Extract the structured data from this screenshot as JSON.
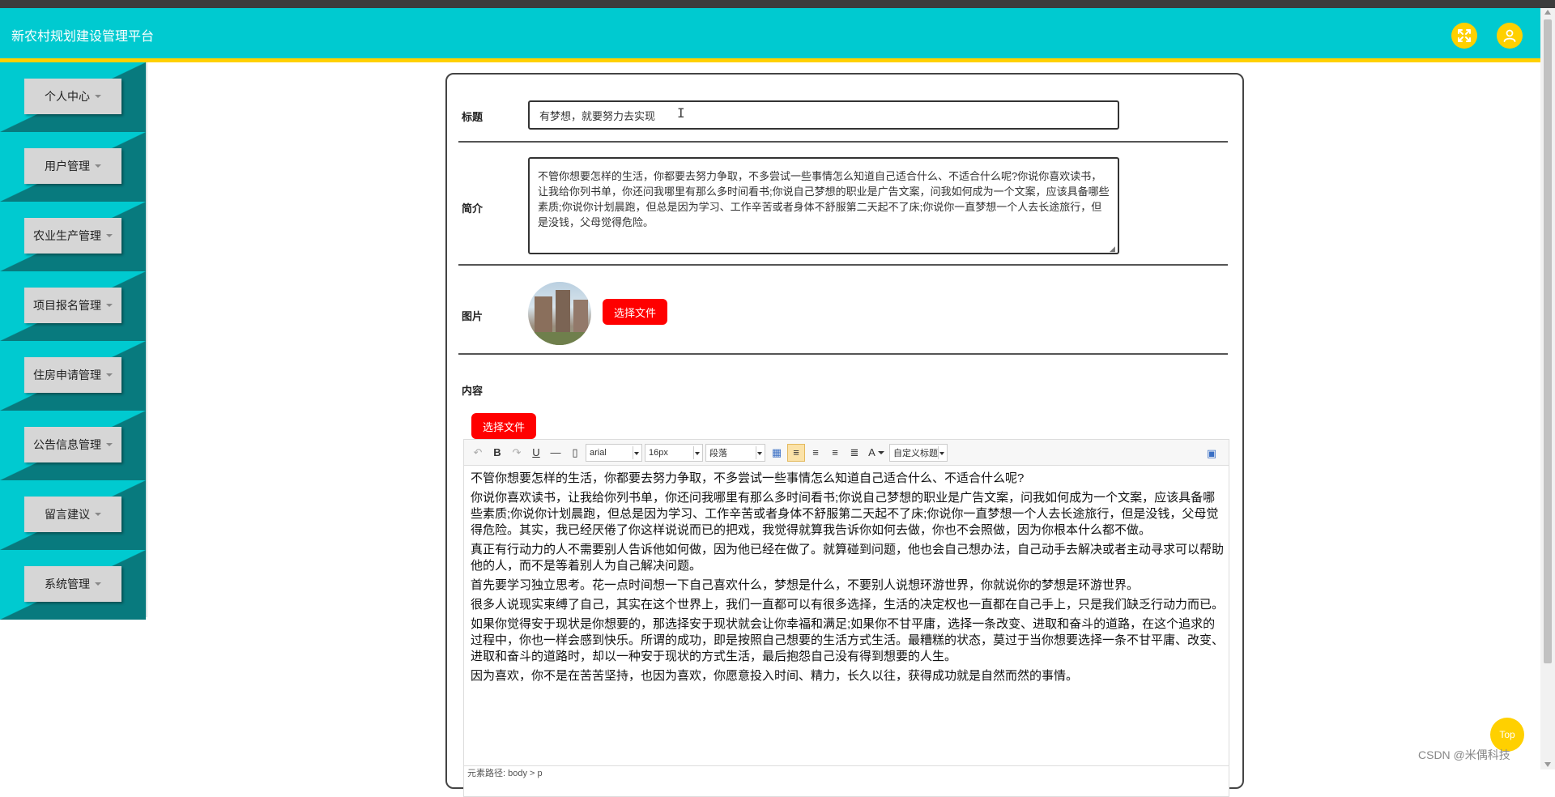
{
  "header": {
    "title": "新农村规划建设管理平台"
  },
  "sidebar": {
    "items": [
      {
        "label": "个人中心"
      },
      {
        "label": "用户管理"
      },
      {
        "label": "农业生产管理"
      },
      {
        "label": "项目报名管理"
      },
      {
        "label": "住房申请管理"
      },
      {
        "label": "公告信息管理"
      },
      {
        "label": "留言建议"
      },
      {
        "label": "系统管理"
      }
    ]
  },
  "form": {
    "title_label": "标题",
    "title_value": "有梦想，就要努力去实现",
    "intro_label": "简介",
    "intro_value": "不管你想要怎样的生活，你都要去努力争取，不多尝试一些事情怎么知道自己适合什么、不适合什么呢?你说你喜欢读书，让我给你列书单，你还问我哪里有那么多时间看书;你说自己梦想的职业是广告文案，问我如何成为一个文案，应该具备哪些素质;你说你计划晨跑，但总是因为学习、工作辛苦或者身体不舒服第二天起不了床;你说你一直梦想一个人去长途旅行，但是没钱，父母觉得危险。",
    "image_label": "图片",
    "choose_file": "选择文件",
    "content_label": "内容",
    "content_choose_file": "选择文件"
  },
  "editor": {
    "font_family": "arial",
    "font_size": "16px",
    "paragraph": "段落",
    "custom_title": "自定义标题",
    "paragraphs": [
      "不管你想要怎样的生活，你都要去努力争取，不多尝试一些事情怎么知道自己适合什么、不适合什么呢?",
      "你说你喜欢读书，让我给你列书单，你还问我哪里有那么多时间看书;你说自己梦想的职业是广告文案，问我如何成为一个文案，应该具备哪些素质;你说你计划晨跑，但总是因为学习、工作辛苦或者身体不舒服第二天起不了床;你说你一直梦想一个人去长途旅行，但是没钱，父母觉得危险。其实，我已经厌倦了你这样说说而已的把戏，我觉得就算我告诉你如何去做，你也不会照做，因为你根本什么都不做。",
      "真正有行动力的人不需要别人告诉他如何做，因为他已经在做了。就算碰到问题，他也会自己想办法，自己动手去解决或者主动寻求可以帮助他的人，而不是等着别人为自己解决问题。",
      "首先要学习独立思考。花一点时间想一下自己喜欢什么，梦想是什么，不要别人说想环游世界，你就说你的梦想是环游世界。",
      "很多人说现实束缚了自己，其实在这个世界上，我们一直都可以有很多选择，生活的决定权也一直都在自己手上，只是我们缺乏行动力而已。",
      "如果你觉得安于现状是你想要的，那选择安于现状就会让你幸福和满足;如果你不甘平庸，选择一条改变、进取和奋斗的道路，在这个追求的过程中，你也一样会感到快乐。所谓的成功，即是按照自己想要的生活方式生活。最糟糕的状态，莫过于当你想要选择一条不甘平庸、改变、进取和奋斗的道路时，却以一种安于现状的方式生活，最后抱怨自己没有得到想要的人生。",
      "因为喜欢，你不是在苦苦坚持，也因为喜欢，你愿意投入时间、精力，长久以往，获得成功就是自然而然的事情。"
    ],
    "element_path": "元素路径: body > p"
  },
  "top_button": "Top",
  "watermark": "CSDN @米偶科技",
  "colors": {
    "header": "#00cad0",
    "accent": "#ffd000",
    "sidebar_shadow": "#087a7e",
    "danger": "#ff0000"
  }
}
